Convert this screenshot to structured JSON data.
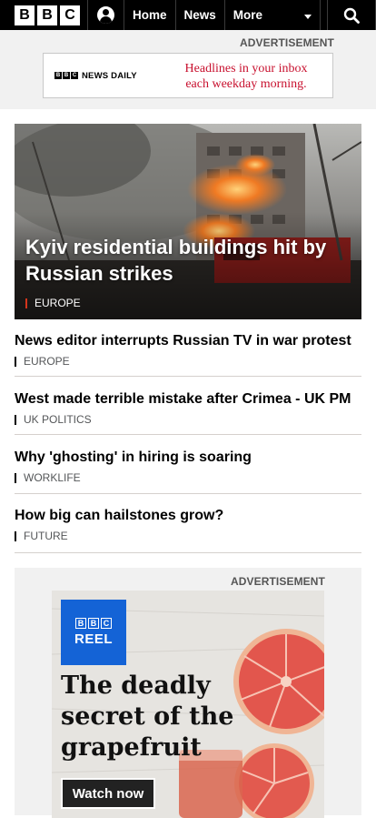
{
  "header": {
    "logo_letters": [
      "B",
      "B",
      "C"
    ],
    "nav": {
      "home": "Home",
      "news": "News",
      "more": "More"
    },
    "colors": {
      "bar": "#000000",
      "text": "#ffffff"
    }
  },
  "ad_top": {
    "label": "ADVERTISEMENT",
    "brand": "NEWS DAILY",
    "brand_letters": [
      "B",
      "B",
      "C"
    ],
    "text_line1": "Headlines in your inbox",
    "text_line2": "each weekday morning.",
    "accent": "#c8102e"
  },
  "hero": {
    "title": "Kyiv residential buildings hit by Russian strikes",
    "tag": "EUROPE",
    "tag_color": "#d4351c"
  },
  "stories": [
    {
      "title": "News editor interrupts Russian TV in war protest",
      "tag": "EUROPE"
    },
    {
      "title": "West made terrible mistake after Crimea - UK PM",
      "tag": "UK POLITICS"
    },
    {
      "title": "Why 'ghosting' in hiring is soaring",
      "tag": "WORKLIFE"
    },
    {
      "title": "How big can hailstones grow?",
      "tag": "FUTURE"
    }
  ],
  "ad_bottom": {
    "label": "ADVERTISEMENT",
    "reel_letters": [
      "B",
      "B",
      "C"
    ],
    "reel_word": "REEL",
    "headline": "The deadly secret of the grapefruit",
    "cta": "Watch now",
    "reel_color": "#1463d6"
  }
}
